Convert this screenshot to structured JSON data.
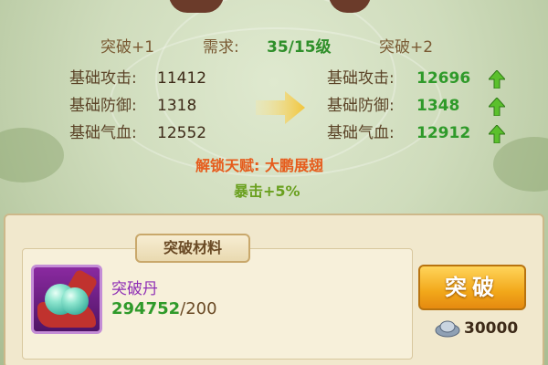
{
  "stats": {
    "current_label": "突破+1",
    "requirement_label": "需求:",
    "requirement_value": "35/15级",
    "next_label": "突破+2",
    "rows": [
      {
        "label": "基础攻击:",
        "current": "11412",
        "next": "12696"
      },
      {
        "label": "基础防御:",
        "current": "1318",
        "next": "1348"
      },
      {
        "label": "基础气血:",
        "current": "12552",
        "next": "12912"
      }
    ]
  },
  "unlock": {
    "text": "解锁天赋: 大鹏展翅",
    "bonus": "暴击+5%"
  },
  "materials": {
    "title": "突破材料",
    "item": {
      "name": "突破丹",
      "owned": "294752",
      "required_text": "/200",
      "icon": "breakthrough-pill-icon"
    }
  },
  "action": {
    "button_label": "突破",
    "cost": "30000",
    "cost_icon": "silver-ingot-icon"
  },
  "colors": {
    "increase": "#2f9a2a",
    "unlock_text": "#e65c1c",
    "button": "#f2a81a",
    "item_name": "#8f2fb5"
  }
}
